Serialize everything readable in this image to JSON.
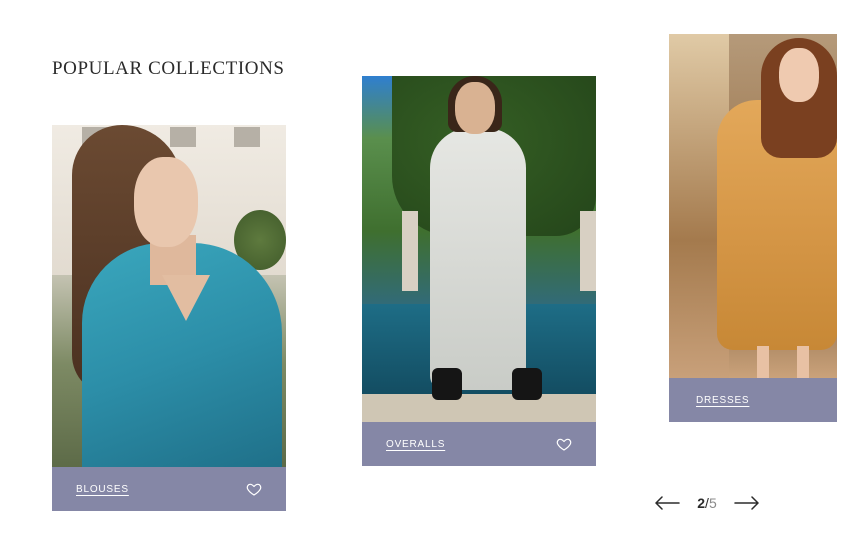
{
  "section": {
    "title": "POPULAR COLLECTIONS"
  },
  "cards": [
    {
      "label": "BLOUSES",
      "icon": "heart-outline-icon"
    },
    {
      "label": "OVERALLS",
      "icon": "heart-outline-icon"
    },
    {
      "label": "DRESSES"
    }
  ],
  "pager": {
    "current": "2",
    "separator": "/",
    "total": "5",
    "prev_icon": "arrow-left-icon",
    "next_icon": "arrow-right-icon"
  },
  "colors": {
    "card_bar": "#8587a6",
    "text_dark": "#2b2b2b",
    "label_text": "#ffffff"
  }
}
